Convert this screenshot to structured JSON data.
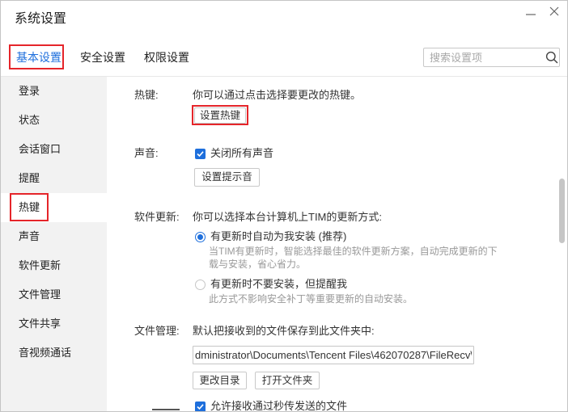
{
  "window": {
    "title": "系统设置",
    "minimize_icon": "minimize-icon",
    "close_icon": "close-icon"
  },
  "tabs": [
    {
      "label": "基本设置",
      "active": true
    },
    {
      "label": "安全设置",
      "active": false
    },
    {
      "label": "权限设置",
      "active": false
    }
  ],
  "search": {
    "placeholder": "搜索设置项",
    "value": "",
    "icon": "search-icon"
  },
  "sidebar": {
    "items": [
      {
        "label": "登录",
        "selected": false
      },
      {
        "label": "状态",
        "selected": false
      },
      {
        "label": "会话窗口",
        "selected": false
      },
      {
        "label": "提醒",
        "selected": false
      },
      {
        "label": "热键",
        "selected": true
      },
      {
        "label": "声音",
        "selected": false
      },
      {
        "label": "软件更新",
        "selected": false
      },
      {
        "label": "文件管理",
        "selected": false
      },
      {
        "label": "文件共享",
        "selected": false
      },
      {
        "label": "音视频通话",
        "selected": false
      }
    ]
  },
  "hotkey": {
    "label": "热键:",
    "description": "你可以通过点击选择要更改的热键。",
    "button": "设置热键"
  },
  "sound": {
    "label": "声音:",
    "mute_all": {
      "label": "关闭所有声音",
      "checked": true
    },
    "button": "设置提示音"
  },
  "update": {
    "label": "软件更新:",
    "description": "你可以选择本台计算机上TIM的更新方式:",
    "options": [
      {
        "label": "有更新时自动为我安装 (推荐)",
        "selected": true,
        "hint_lines": [
          "当TIM有更新时，智能选择最佳的软件更新方案，自动完成更新的下",
          "载与安装，省心省力。"
        ]
      },
      {
        "label": "有更新时不要安装，但提醒我",
        "selected": false,
        "hint_lines": [
          "此方式不影响安全补丁等重要更新的自动安装。"
        ]
      }
    ]
  },
  "file": {
    "label": "文件管理:",
    "description": "默认把接收到的文件保存到此文件夹中:",
    "path": "dministrator\\Documents\\Tencent Files\\462070287\\FileRecv\\",
    "change_button": "更改目录",
    "open_button": "打开文件夹",
    "allow_instant": {
      "label": "允许接收通过秒传发送的文件",
      "checked": true
    }
  },
  "icons": {
    "checkbox_mark": "checkmark-icon",
    "radio_dot": "radio-dot-icon"
  },
  "colors": {
    "accent": "#1e6fdc",
    "highlight": "#e5252a",
    "sidebar_bg": "#f2f2f2",
    "hint_text": "#999999"
  }
}
